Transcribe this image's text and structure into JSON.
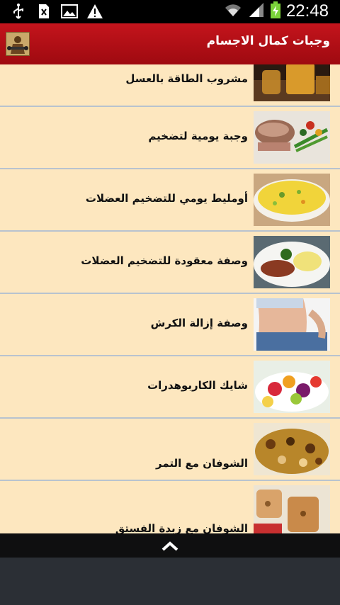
{
  "status": {
    "time": "22:48",
    "icons": [
      "usb-icon",
      "sim-card-x-icon",
      "image-icon",
      "warning-icon",
      "wifi-icon",
      "signal-icon",
      "battery-charging-icon"
    ]
  },
  "app": {
    "title": "وجبات كمال الاجسام",
    "logo_icon": "app-logo-icon"
  },
  "list": {
    "items": [
      {
        "label": "مشروب الطاقة بالعسل",
        "thumb": "honey-drink-thumbnail"
      },
      {
        "label": "وجبة يومية لتضخيم",
        "thumb": "meat-salad-thumbnail"
      },
      {
        "label": "أومليط يومي للتضخيم  العضلات",
        "thumb": "omelette-thumbnail"
      },
      {
        "label": "وصفة معقودة للتضخيم  العضلات",
        "thumb": "meal-plate-thumbnail"
      },
      {
        "label": "وصفة إزالة الكرش",
        "thumb": "belly-thumbnail"
      },
      {
        "label": "شايك الكاربوهدرات",
        "thumb": "fruit-bowl-thumbnail"
      },
      {
        "label": "الشوفان مع التمر",
        "thumb": "oats-dates-thumbnail"
      },
      {
        "label": "الشوفان مع زبدة الفستق",
        "thumb": "oats-peanut-thumbnail"
      }
    ]
  },
  "bottom": {
    "icon": "chevron-up-icon"
  },
  "colors": {
    "actionbar": "#b5121b",
    "list_bg": "#fde7bf",
    "divider": "#b8c3cf"
  }
}
